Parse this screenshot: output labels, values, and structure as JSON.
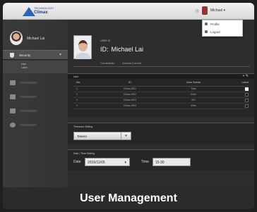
{
  "topbar": {
    "logo_text": "Climax",
    "logo_subtext": "TECHNOLOGY",
    "user_label": "Michael ▾"
  },
  "dropdown": {
    "items": [
      "Profile",
      "Logout"
    ]
  },
  "sidebar": {
    "user_name": "Michael Lai",
    "security_label": "Security",
    "sub_items": [
      "User",
      "Latch"
    ],
    "items": [
      "Settings",
      "Events",
      "Logs",
      "Help"
    ]
  },
  "profile": {
    "caption": "USER ID",
    "id": "ID:",
    "name": "Michael Lai",
    "tabs": [
      "Credentials",
      "Access Control"
    ]
  },
  "user_table": {
    "title": "User",
    "columns": [
      "No.",
      "ID",
      "User Name",
      "Latch"
    ],
    "rows": [
      {
        "no": "1",
        "id": "Climax-0001",
        "name": "Sam",
        "latch": true
      },
      {
        "no": "2",
        "id": "Climax-0002",
        "name": "Kevin",
        "latch": false
      },
      {
        "no": "3",
        "id": "Climax-0003",
        "name": "Mel",
        "latch": false
      },
      {
        "no": "4",
        "id": "Climax-0004",
        "name": "Moss",
        "latch": false
      }
    ]
  },
  "timezone": {
    "title": "Timezone Setting",
    "value": "Taiwan"
  },
  "datetime": {
    "title": "Date / Time Setting",
    "date_label": "Date",
    "date_value": "2016/11/05",
    "time_label": "Time",
    "time_value": "15:30"
  },
  "caption": "User Management"
}
